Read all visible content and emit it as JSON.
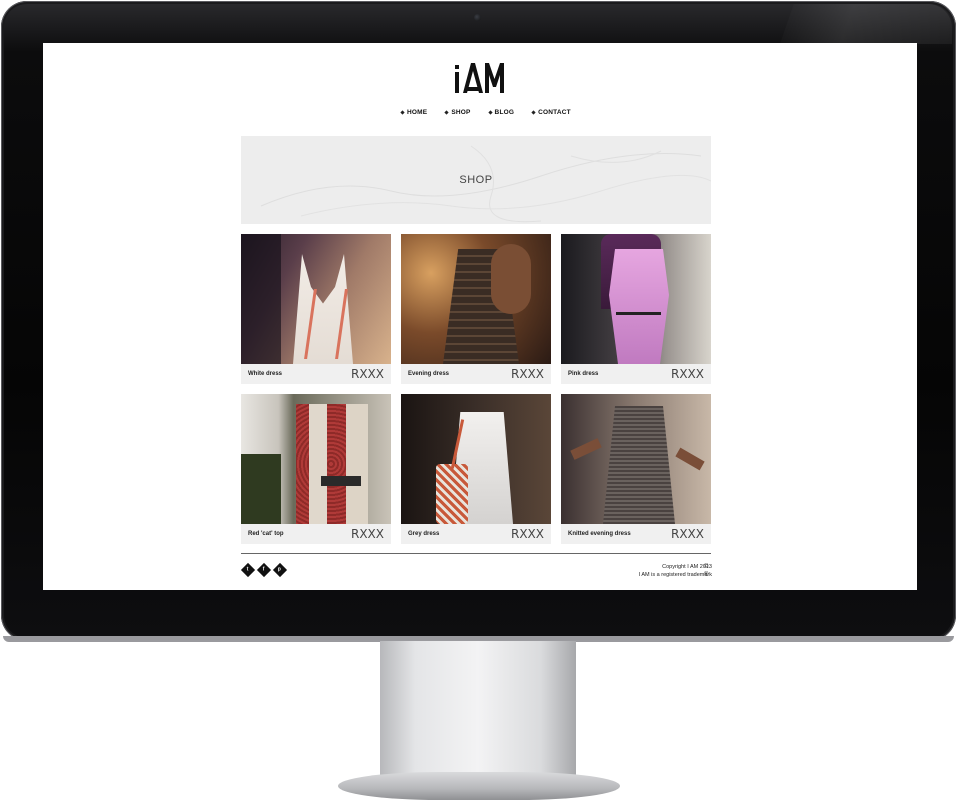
{
  "site": {
    "logo": "iAM",
    "nav": [
      {
        "label": "HOME"
      },
      {
        "label": "SHOP"
      },
      {
        "label": "BLOG"
      },
      {
        "label": "CONTACT"
      }
    ],
    "banner_title": "SHOP",
    "products": [
      {
        "name": "White dress",
        "price": "RXXX"
      },
      {
        "name": "Evening dress",
        "price": "RXXX"
      },
      {
        "name": "Pink dress",
        "price": "RXXX"
      },
      {
        "name": "Red 'cat' top",
        "price": "RXXX"
      },
      {
        "name": "Grey dress",
        "price": "RXXX"
      },
      {
        "name": "Knitted evening dress",
        "price": "RXXX"
      }
    ],
    "footer": {
      "copyright": "Copyright I AM 2013",
      "trademark": "I AM is a registered trademark",
      "copyright_symbol": "©",
      "registered_symbol": "®",
      "social_icons": [
        "twitter-icon",
        "facebook-icon",
        "pinterest-icon"
      ]
    }
  },
  "colors": {
    "bezel": "#050505",
    "banner_bg": "#ededed",
    "caption_bg": "#f0f0f0",
    "text": "#222222"
  }
}
